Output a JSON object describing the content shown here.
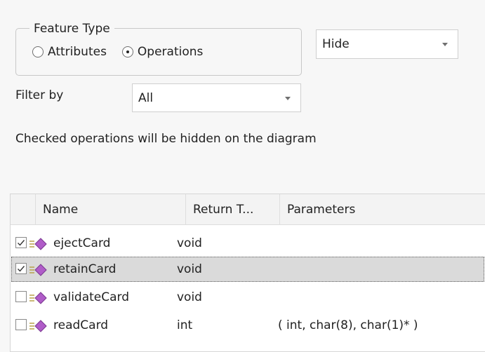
{
  "feature_type": {
    "legend": "Feature Type",
    "options": [
      {
        "label": "Attributes",
        "selected": false
      },
      {
        "label": "Operations",
        "selected": true
      }
    ]
  },
  "visibility_select": {
    "value": "Hide"
  },
  "filter": {
    "label": "Filter by",
    "value": "All"
  },
  "info_text": "Checked operations will be hidden on the diagram",
  "table": {
    "columns": [
      "Name",
      "Return T...",
      "Parameters"
    ],
    "rows": [
      {
        "checked": true,
        "name": "ejectCard",
        "return_type": "void",
        "parameters": "",
        "selected": false
      },
      {
        "checked": true,
        "name": "retainCard",
        "return_type": "void",
        "parameters": "",
        "selected": true
      },
      {
        "checked": false,
        "name": "validateCard",
        "return_type": "void",
        "parameters": "",
        "selected": false
      },
      {
        "checked": false,
        "name": "readCard",
        "return_type": "int",
        "parameters": "( int, char(8), char(1)* )",
        "selected": false
      }
    ]
  },
  "colors": {
    "background": "#f7f7f7",
    "selected_row": "#dadada",
    "operation_icon": "#b05cc8"
  },
  "icons": {
    "operation": "operation-icon",
    "dropdown": "chevron-down-icon"
  }
}
